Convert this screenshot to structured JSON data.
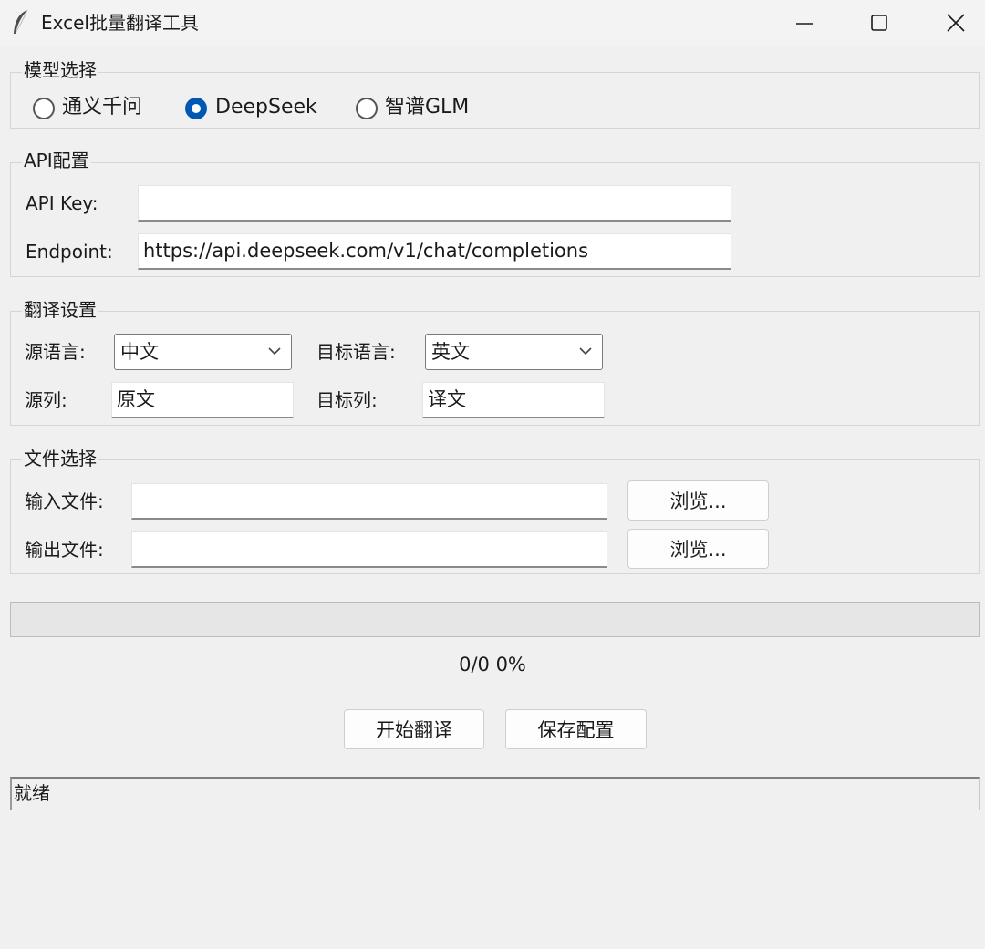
{
  "window": {
    "title": "Excel批量翻译工具",
    "icon": "feather-icon",
    "controls": [
      "minimize-icon",
      "maximize-icon",
      "close-icon"
    ]
  },
  "model_group": {
    "label": "模型选择",
    "options": [
      {
        "label": "通义千问",
        "selected": false
      },
      {
        "label": "DeepSeek",
        "selected": true
      },
      {
        "label": "智谱GLM",
        "selected": false
      }
    ]
  },
  "api_group": {
    "label": "API配置",
    "api_key_label": "API Key:",
    "api_key_value": "",
    "endpoint_label": "Endpoint:",
    "endpoint_value": "https://api.deepseek.com/v1/chat/completions"
  },
  "translate_group": {
    "label": "翻译设置",
    "source_lang_label": "源语言:",
    "source_lang_value": "中文",
    "target_lang_label": "目标语言:",
    "target_lang_value": "英文",
    "source_col_label": "源列:",
    "source_col_value": "原文",
    "target_col_label": "目标列:",
    "target_col_value": "译文"
  },
  "file_group": {
    "label": "文件选择",
    "input_label": "输入文件:",
    "input_value": "",
    "output_label": "输出文件:",
    "output_value": "",
    "browse_label": "浏览..."
  },
  "progress": {
    "fraction": 0,
    "text": "0/0  0%"
  },
  "actions": {
    "start_label": "开始翻译",
    "save_label": "保存配置"
  },
  "status": {
    "text": "就绪"
  },
  "colors": {
    "accent": "#0058b3",
    "background": "#f0f0f0"
  }
}
